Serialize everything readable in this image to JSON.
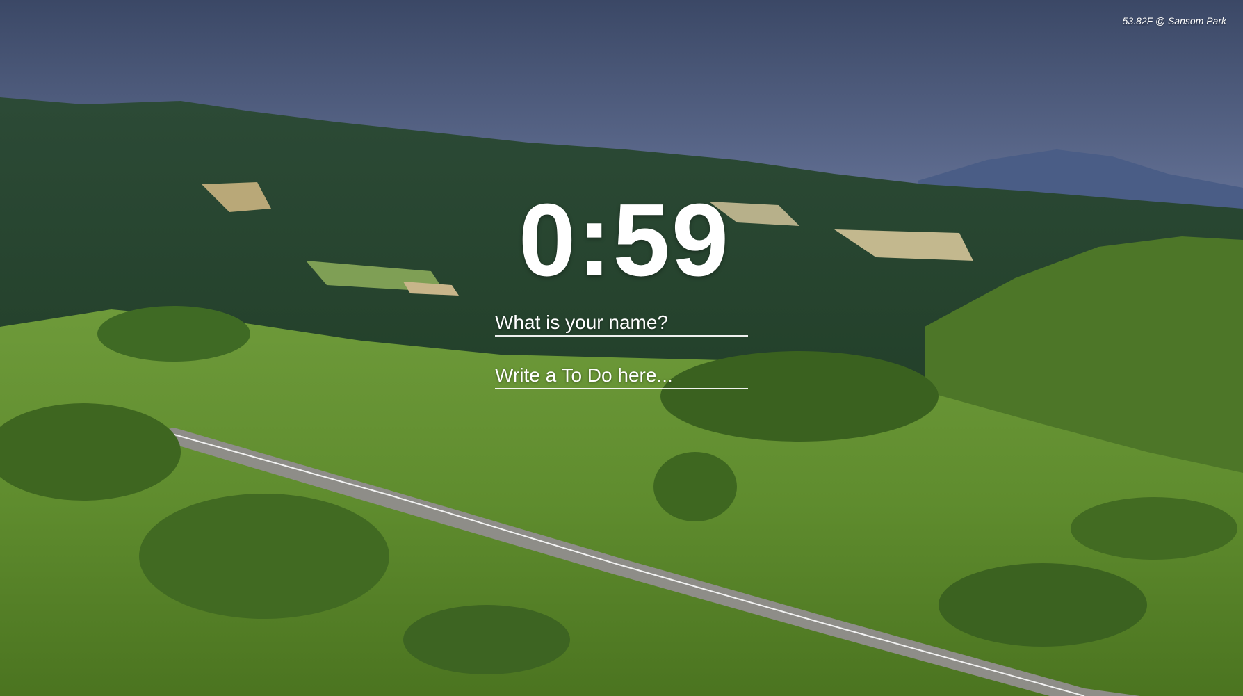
{
  "background": {
    "sky_color": "#7f8db5",
    "hill_color": "#2b4a30",
    "grass_color": "#6f9a36",
    "road_color": "#8c8c8a"
  },
  "weather": {
    "text": "53.82F @ Sansom Park"
  },
  "clock": {
    "time": "0:59"
  },
  "name_input": {
    "placeholder": "What is your name?",
    "value": ""
  },
  "todo_input": {
    "placeholder": "Write a To Do here...",
    "value": ""
  }
}
